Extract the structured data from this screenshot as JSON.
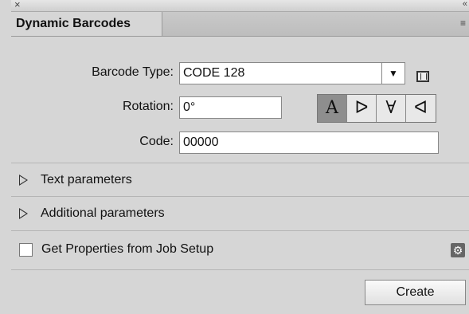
{
  "window": {
    "close_glyph": "×",
    "collapse_glyph": "«"
  },
  "tab": {
    "title": "Dynamic Barcodes",
    "menu_glyph": "≡"
  },
  "form": {
    "barcode_type": {
      "label": "Barcode Type:",
      "value": "CODE 128",
      "arrow": "▼"
    },
    "rotation": {
      "label": "Rotation:",
      "value": "0°"
    },
    "code": {
      "label": "Code:",
      "value": "00000"
    },
    "rotation_buttons": [
      {
        "glyph": "A",
        "active": true
      },
      {
        "glyph": "ᐅ",
        "active": false
      },
      {
        "glyph": "∀",
        "active": false
      },
      {
        "glyph": "ᐊ",
        "active": false
      }
    ]
  },
  "sections": {
    "text_parameters": "Text parameters",
    "additional_parameters": "Additional parameters"
  },
  "job_setup": {
    "label": "Get Properties from Job Setup",
    "checked": false,
    "gear_glyph": "⚙"
  },
  "actions": {
    "create_label": "Create"
  }
}
